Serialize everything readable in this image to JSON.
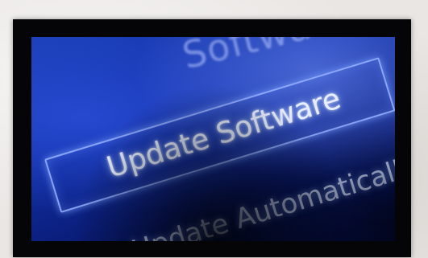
{
  "screen": {
    "heading": "Softwa",
    "menu": {
      "items": [
        {
          "label": "Update Software",
          "selected": true
        },
        {
          "label": "Update Automatically",
          "selected": false
        }
      ]
    }
  },
  "colors": {
    "screen_blue": "#1230a6",
    "highlight_border": "#96afff",
    "frame": "#050507",
    "background": "#e9e6e3"
  }
}
